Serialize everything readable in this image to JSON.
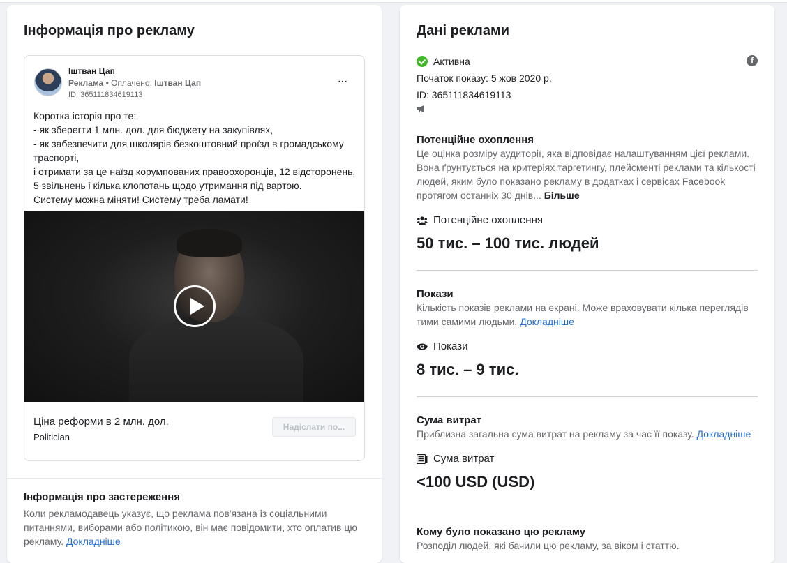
{
  "left": {
    "title": "Інформація про рекламу",
    "ad": {
      "advertiser": "Іштван Цап",
      "sponsored_label": "Реклама",
      "paid_by_prefix": " • Оплачено: ",
      "paid_by": "Іштван Цап",
      "id_line": "ID: 365111834619113",
      "more_icon": "…",
      "body_lines": [
        "Коротка історія про те:",
        "- як зберегти 1 млн. дол. для бюджету на закупівлях,",
        "- як забезпечити для школярів безкоштовний проїзд в громадському",
        "траспорті,",
        "і отримати за це наїзд корумпованих правоохоронців, 12 відсторонень,",
        "5 звільнень і кілька клопотань щодо утримання під вартою.",
        "Систему можна міняти! Систему треба ламати!"
      ],
      "cta_title": "Ціна реформи в 2 млн. дол.",
      "cta_subtitle": "Politician",
      "cta_button": "Надіслати по..."
    },
    "disclaimer": {
      "title": "Інформація про застереження",
      "text": "Коли рекламодавець указує, що реклама пов'язана із соціальними питаннями, виборами або політикою, він має повідомити, хто оплатив цю рекламу.",
      "link": "Докладніше"
    }
  },
  "right": {
    "title": "Дані реклами",
    "status": "Активна",
    "start": "Початок показу: 5 жов 2020 р.",
    "id": "ID: 365111834619113",
    "facebook_icon": "f",
    "reach": {
      "title": "Потенційне охоплення",
      "description": "Це оцінка розміру аудиторії, яка відповідає налаштуванням цієї реклами. Вона ґрунтується на критеріях таргетингу, плейсменті реклами та кількості людей, яким було показано рекламу в додатках і сервісах Facebook протягом останніх 30 днів... ",
      "more": "Більше",
      "label": "Потенційне охоплення",
      "value": "50 тис. – 100 тис. людей"
    },
    "impressions": {
      "title": "Покази",
      "description": "Кількість показів реклами на екрані. Може враховувати кілька переглядів тими самими людьми. ",
      "link": "Докладніше",
      "label": "Покази",
      "value": "8 тис. – 9 тис."
    },
    "spend": {
      "title": "Сума витрат",
      "description": "Приблизна загальна сума витрат на рекламу за час її показу. ",
      "link": "Докладніше",
      "label": "Сума витрат",
      "value": "<100 USD (USD)"
    },
    "audience": {
      "title": "Кому було показано цю рекламу",
      "description": "Розподіл людей, які бачили цю рекламу, за віком і статтю."
    }
  }
}
